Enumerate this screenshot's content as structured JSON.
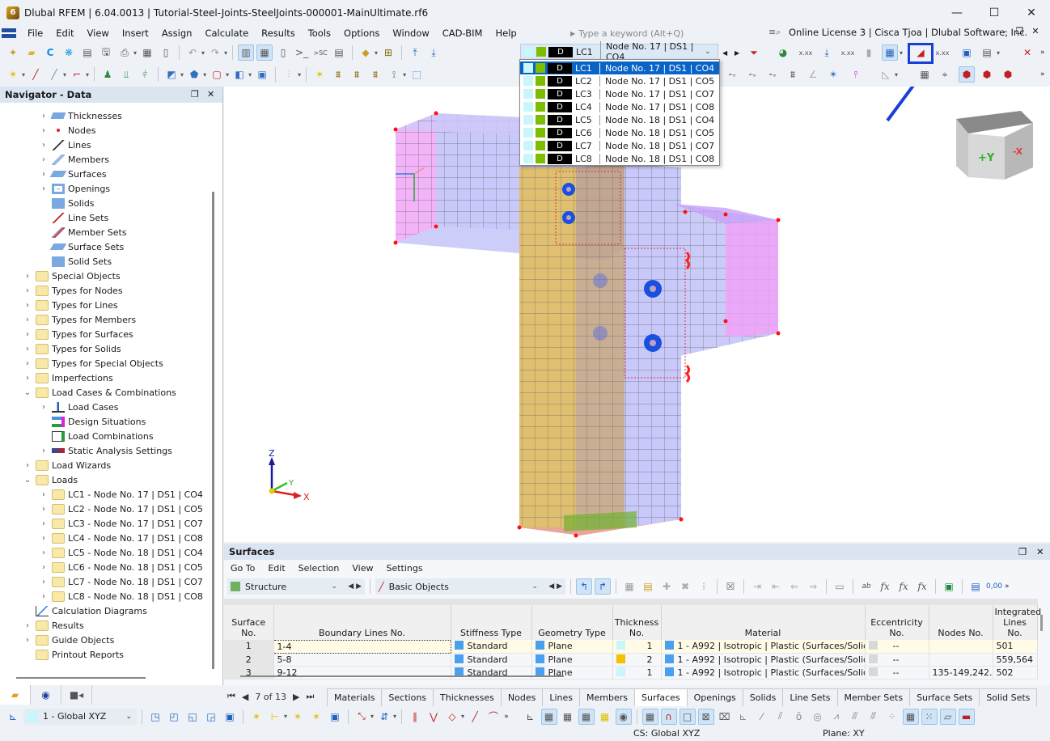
{
  "window": {
    "title": "Dlubal RFEM | 6.04.0013 | Tutorial-Steel-Joints-SteelJoints-000001-MainUltimate.rf6",
    "minimize": "—",
    "maximize": "☐",
    "close": "✕"
  },
  "menu": {
    "items": [
      "File",
      "Edit",
      "View",
      "Insert",
      "Assign",
      "Calculate",
      "Results",
      "Tools",
      "Options",
      "Window",
      "CAD-BIM",
      "Help"
    ],
    "search_placeholder": "Type a keyword (Alt+Q)",
    "license": "Online License 3 | Cisca Tjoa | Dlubal Software, Inc."
  },
  "load_case_selector": {
    "selected": {
      "type": "D",
      "code": "LC1",
      "name": "Node No. 17 | DS1 | CO4"
    },
    "options": [
      {
        "type": "D",
        "code": "LC1",
        "name": "Node No. 17 | DS1 | CO4"
      },
      {
        "type": "D",
        "code": "LC2",
        "name": "Node No. 17 | DS1 | CO5"
      },
      {
        "type": "D",
        "code": "LC3",
        "name": "Node No. 17 | DS1 | CO7"
      },
      {
        "type": "D",
        "code": "LC4",
        "name": "Node No. 17 | DS1 | CO8"
      },
      {
        "type": "D",
        "code": "LC5",
        "name": "Node No. 18 | DS1 | CO4"
      },
      {
        "type": "D",
        "code": "LC6",
        "name": "Node No. 18 | DS1 | CO5"
      },
      {
        "type": "D",
        "code": "LC7",
        "name": "Node No. 18 | DS1 | CO7"
      },
      {
        "type": "D",
        "code": "LC8",
        "name": "Node No. 18 | DS1 | CO8"
      }
    ],
    "colors": {
      "swatch1": "#c8f6fb",
      "swatch2": "#7cbd00",
      "type_bg": "#000000",
      "selected_bg": "#0a64c8"
    }
  },
  "navigator": {
    "title": "Navigator - Data",
    "items": [
      {
        "label": "Thicknesses",
        "icon": "thickness-icon",
        "expandable": true
      },
      {
        "label": "Nodes",
        "icon": "node-icon",
        "expandable": true
      },
      {
        "label": "Lines",
        "icon": "line-icon",
        "expandable": true
      },
      {
        "label": "Members",
        "icon": "member-icon",
        "expandable": true
      },
      {
        "label": "Surfaces",
        "icon": "surface-icon",
        "expandable": true
      },
      {
        "label": "Openings",
        "icon": "opening-icon",
        "expandable": true
      },
      {
        "label": "Solids",
        "icon": "solid-icon",
        "expandable": false
      },
      {
        "label": "Line Sets",
        "icon": "line-set-icon",
        "expandable": false
      },
      {
        "label": "Member Sets",
        "icon": "member-set-icon",
        "expandable": false
      },
      {
        "label": "Surface Sets",
        "icon": "surface-set-icon",
        "expandable": false
      },
      {
        "label": "Solid Sets",
        "icon": "solid-set-icon",
        "expandable": false
      },
      {
        "label": "Special Objects",
        "icon": "folder-icon",
        "expandable": true
      },
      {
        "label": "Types for Nodes",
        "icon": "folder-icon",
        "expandable": true
      },
      {
        "label": "Types for Lines",
        "icon": "folder-icon",
        "expandable": true
      },
      {
        "label": "Types for Members",
        "icon": "folder-icon",
        "expandable": true
      },
      {
        "label": "Types for Surfaces",
        "icon": "folder-icon",
        "expandable": true
      },
      {
        "label": "Types for Solids",
        "icon": "folder-icon",
        "expandable": true
      },
      {
        "label": "Types for Special Objects",
        "icon": "folder-icon",
        "expandable": true
      },
      {
        "label": "Imperfections",
        "icon": "folder-icon",
        "expandable": true
      },
      {
        "label": "Load Cases & Combinations",
        "icon": "folder-icon",
        "expanded": true
      },
      {
        "label": "Load Cases",
        "icon": "load-case-icon",
        "expandable": true
      },
      {
        "label": "Design Situations",
        "icon": "design-situation-icon",
        "expandable": false
      },
      {
        "label": "Load Combinations",
        "icon": "load-combination-icon",
        "expandable": false
      },
      {
        "label": "Static Analysis Settings",
        "icon": "static-analysis-icon",
        "expandable": true
      },
      {
        "label": "Load Wizards",
        "icon": "folder-icon",
        "expandable": true
      },
      {
        "label": "Loads",
        "icon": "folder-icon",
        "expanded": true
      },
      {
        "label": "LC1 - Node No. 17 | DS1 | CO4",
        "icon": "folder-icon",
        "expandable": true
      },
      {
        "label": "LC2 - Node No. 17 | DS1 | CO5",
        "icon": "folder-icon",
        "expandable": true
      },
      {
        "label": "LC3 - Node No. 17 | DS1 | CO7",
        "icon": "folder-icon",
        "expandable": true
      },
      {
        "label": "LC4 - Node No. 17 | DS1 | CO8",
        "icon": "folder-icon",
        "expandable": true
      },
      {
        "label": "LC5 - Node No. 18 | DS1 | CO4",
        "icon": "folder-icon",
        "expandable": true
      },
      {
        "label": "LC6 - Node No. 18 | DS1 | CO5",
        "icon": "folder-icon",
        "expandable": true
      },
      {
        "label": "LC7 - Node No. 18 | DS1 | CO7",
        "icon": "folder-icon",
        "expandable": true
      },
      {
        "label": "LC8 - Node No. 18 | DS1 | CO8",
        "icon": "folder-icon",
        "expandable": true
      },
      {
        "label": "Calculation Diagrams",
        "icon": "diagram-icon",
        "expandable": false
      },
      {
        "label": "Results",
        "icon": "folder-icon",
        "expandable": true
      },
      {
        "label": "Guide Objects",
        "icon": "folder-icon",
        "expandable": true
      },
      {
        "label": "Printout Reports",
        "icon": "folder-icon",
        "expandable": false
      }
    ],
    "tabs": [
      "data-icon",
      "view-icon",
      "camera-icon"
    ]
  },
  "viewport": {
    "view_cube": {
      "front": "+Y",
      "side": "-X"
    },
    "axes": {
      "z": "Z",
      "y": "Y",
      "x": "X"
    }
  },
  "surfaces_panel": {
    "title": "Surfaces",
    "menu": [
      "Go To",
      "Edit",
      "Selection",
      "View",
      "Settings"
    ],
    "combo1": "Structure",
    "combo2": "Basic Objects",
    "columns": [
      "Surface\nNo.",
      "Boundary Lines No.",
      "Stiffness Type",
      "Geometry Type",
      "Thickness\nNo.",
      "Material",
      "Eccentricity\nNo.",
      "Nodes No.",
      "Integrated\nLines No."
    ],
    "rows": [
      {
        "no": "1",
        "boundary": "1-4",
        "stiffness": "Standard",
        "geometry": "Plane",
        "thickness": "1",
        "thickness_color": "#c8f6fb",
        "material": "1 - A992 | Isotropic | Plastic (Surfaces/Solids)",
        "eccentricity": "--",
        "nodes": "",
        "lines": "501"
      },
      {
        "no": "2",
        "boundary": "5-8",
        "stiffness": "Standard",
        "geometry": "Plane",
        "thickness": "2",
        "thickness_color": "#f5c000",
        "material": "1 - A992 | Isotropic | Plastic (Surfaces/Solids)",
        "eccentricity": "--",
        "nodes": "",
        "lines": "559,564"
      },
      {
        "no": "3",
        "boundary": "9-12",
        "stiffness": "Standard",
        "geometry": "Plane",
        "thickness": "1",
        "thickness_color": "#c8f6fb",
        "material": "1 - A992 | Isotropic | Plastic (Surfaces/Solids)",
        "eccentricity": "--",
        "nodes": "135-149,242...",
        "lines": "502"
      }
    ],
    "pager": "7 of 13",
    "tabs": [
      "Materials",
      "Sections",
      "Thicknesses",
      "Nodes",
      "Lines",
      "Members",
      "Surfaces",
      "Openings",
      "Solids",
      "Line Sets",
      "Member Sets",
      "Surface Sets",
      "Solid Sets"
    ],
    "active_tab": "Surfaces"
  },
  "bottom": {
    "coordinate_system": "1 - Global XYZ",
    "status_cs": "CS: Global XYZ",
    "status_plane": "Plane: XY"
  }
}
